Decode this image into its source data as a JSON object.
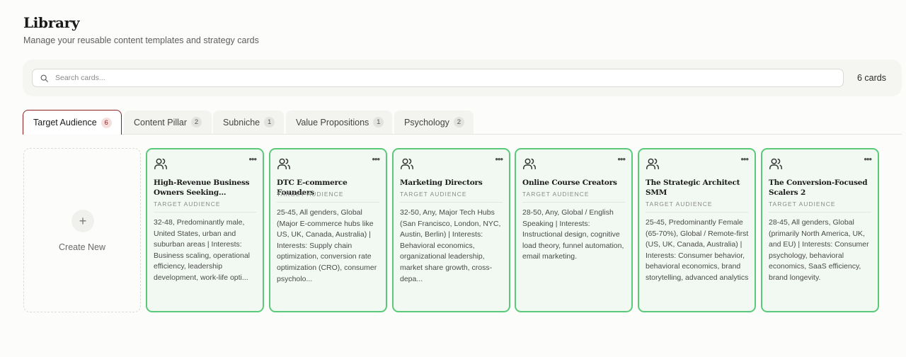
{
  "header": {
    "title": "Library",
    "subtitle": "Manage your reusable content templates and strategy cards"
  },
  "search": {
    "placeholder": "Search cards...",
    "value": "",
    "count_label": "6 cards"
  },
  "tabs": [
    {
      "label": "Target Audience",
      "count": "6",
      "active": true
    },
    {
      "label": "Content Pillar",
      "count": "2",
      "active": false
    },
    {
      "label": "Subniche",
      "count": "1",
      "active": false
    },
    {
      "label": "Value Propositions",
      "count": "1",
      "active": false
    },
    {
      "label": "Psychology",
      "count": "2",
      "active": false
    }
  ],
  "create_new": {
    "label": "Create New",
    "icon": "plus-icon"
  },
  "cards": [
    {
      "icon": "users-icon",
      "title": "High-Revenue Business Owners Seeking...",
      "category": "TARGET AUDIENCE",
      "description": "32-48, Predominantly male, United States, urban and suburban areas | Interests: Business scaling, operational efficiency, leadership development, work-life opti..."
    },
    {
      "icon": "users-icon",
      "title": "DTC E-commerce Founders",
      "category": "TARGET AUDIENCE",
      "description": "25-45, All genders, Global (Major E-commerce hubs like US, UK, Canada, Australia) | Interests: Supply chain optimization, conversion rate optimization (CRO), consumer psycholo..."
    },
    {
      "icon": "users-icon",
      "title": "Marketing Directors",
      "category": "TARGET AUDIENCE",
      "description": "32-50, Any, Major Tech Hubs (San Francisco, London, NYC, Austin, Berlin) | Interests: Behavioral economics, organizational leadership, market share growth, cross-depa..."
    },
    {
      "icon": "users-icon",
      "title": "Online Course Creators",
      "category": "TARGET AUDIENCE",
      "description": "28-50, Any, Global / English Speaking | Interests: Instructional design, cognitive load theory, funnel automation, email marketing."
    },
    {
      "icon": "users-icon",
      "title": "The Strategic Architect SMM",
      "category": "TARGET AUDIENCE",
      "description": "25-45, Predominantly Female (65-70%), Global / Remote-first (US, UK, Canada, Australia) | Interests: Consumer behavior, behavioral economics, brand storytelling, advanced analytics"
    },
    {
      "icon": "users-icon",
      "title": "The Conversion-Focused Scalers 2",
      "category": "TARGET AUDIENCE",
      "description": "28-45, All genders, Global (primarily North America, UK, and EU) | Interests: Consumer psychology, behavioral economics, SaaS efficiency, brand longevity."
    }
  ],
  "colors": {
    "accent": "#8b1e1e",
    "card_border": "#5bc97a",
    "card_bg": "#f1f9f2"
  }
}
